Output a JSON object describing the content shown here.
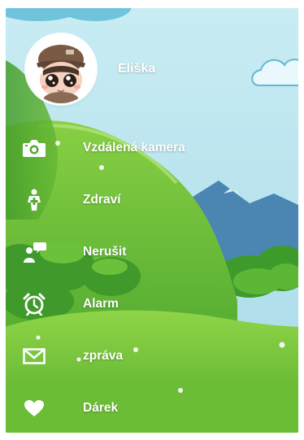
{
  "profile": {
    "name": "Eliška"
  },
  "menu": {
    "items": [
      {
        "label": "Vzdálená kamera",
        "icon": "camera-icon"
      },
      {
        "label": "Zdraví",
        "icon": "health-icon"
      },
      {
        "label": "Nerušit",
        "icon": "do-not-disturb-icon"
      },
      {
        "label": "Alarm",
        "icon": "alarm-clock-icon"
      },
      {
        "label": "zpráva",
        "icon": "message-envelope-icon"
      },
      {
        "label": "Dárek",
        "icon": "heart-icon"
      }
    ]
  },
  "colors": {
    "sky": "#a9dbe9",
    "hill_dark": "#3f9a2b",
    "hill_light": "#7fca3b",
    "mountain": "#4f8fb8",
    "text": "#ffffff"
  }
}
